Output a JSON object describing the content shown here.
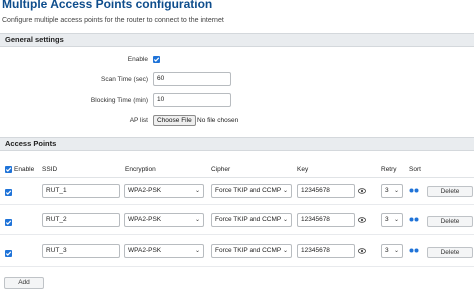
{
  "page": {
    "title": "Multiple Access Points configuration",
    "description": "Configure multiple access points for the router to connect to the internet"
  },
  "general": {
    "header": "General settings",
    "enable_label": "Enable",
    "scan_time_label": "Scan Time (sec)",
    "scan_time_value": "60",
    "blocking_time_label": "Blocking Time (min)",
    "blocking_time_value": "10",
    "ap_list_label": "AP list",
    "choose_file_label": "Choose File",
    "file_status": "No file chosen"
  },
  "access_points": {
    "header": "Access Points",
    "columns": {
      "enable": "Enable",
      "ssid": "SSID",
      "encryption": "Encryption",
      "cipher": "Cipher",
      "key": "Key",
      "retry": "Retry",
      "sort": "Sort"
    },
    "rows": [
      {
        "ssid": "RUT_1",
        "encryption": "WPA2-PSK",
        "cipher": "Force TKIP and CCMP",
        "key": "12345678",
        "retry": "3",
        "delete_label": "Delete"
      },
      {
        "ssid": "RUT_2",
        "encryption": "WPA2-PSK",
        "cipher": "Force TKIP and CCMP",
        "key": "12345678",
        "retry": "3",
        "delete_label": "Delete"
      },
      {
        "ssid": "RUT_3",
        "encryption": "WPA2-PSK",
        "cipher": "Force TKIP and CCMP",
        "key": "12345678",
        "retry": "3",
        "delete_label": "Delete"
      }
    ],
    "add_label": "Add"
  },
  "colors": {
    "title": "#0e4d8c",
    "checkbox": "#1f73d8",
    "section_bg": "#e9ecef"
  },
  "icons": {
    "dropdown": "chevron-down-icon",
    "reveal": "eye-icon",
    "sort": "sort-handle-icon",
    "check": "check-icon"
  }
}
